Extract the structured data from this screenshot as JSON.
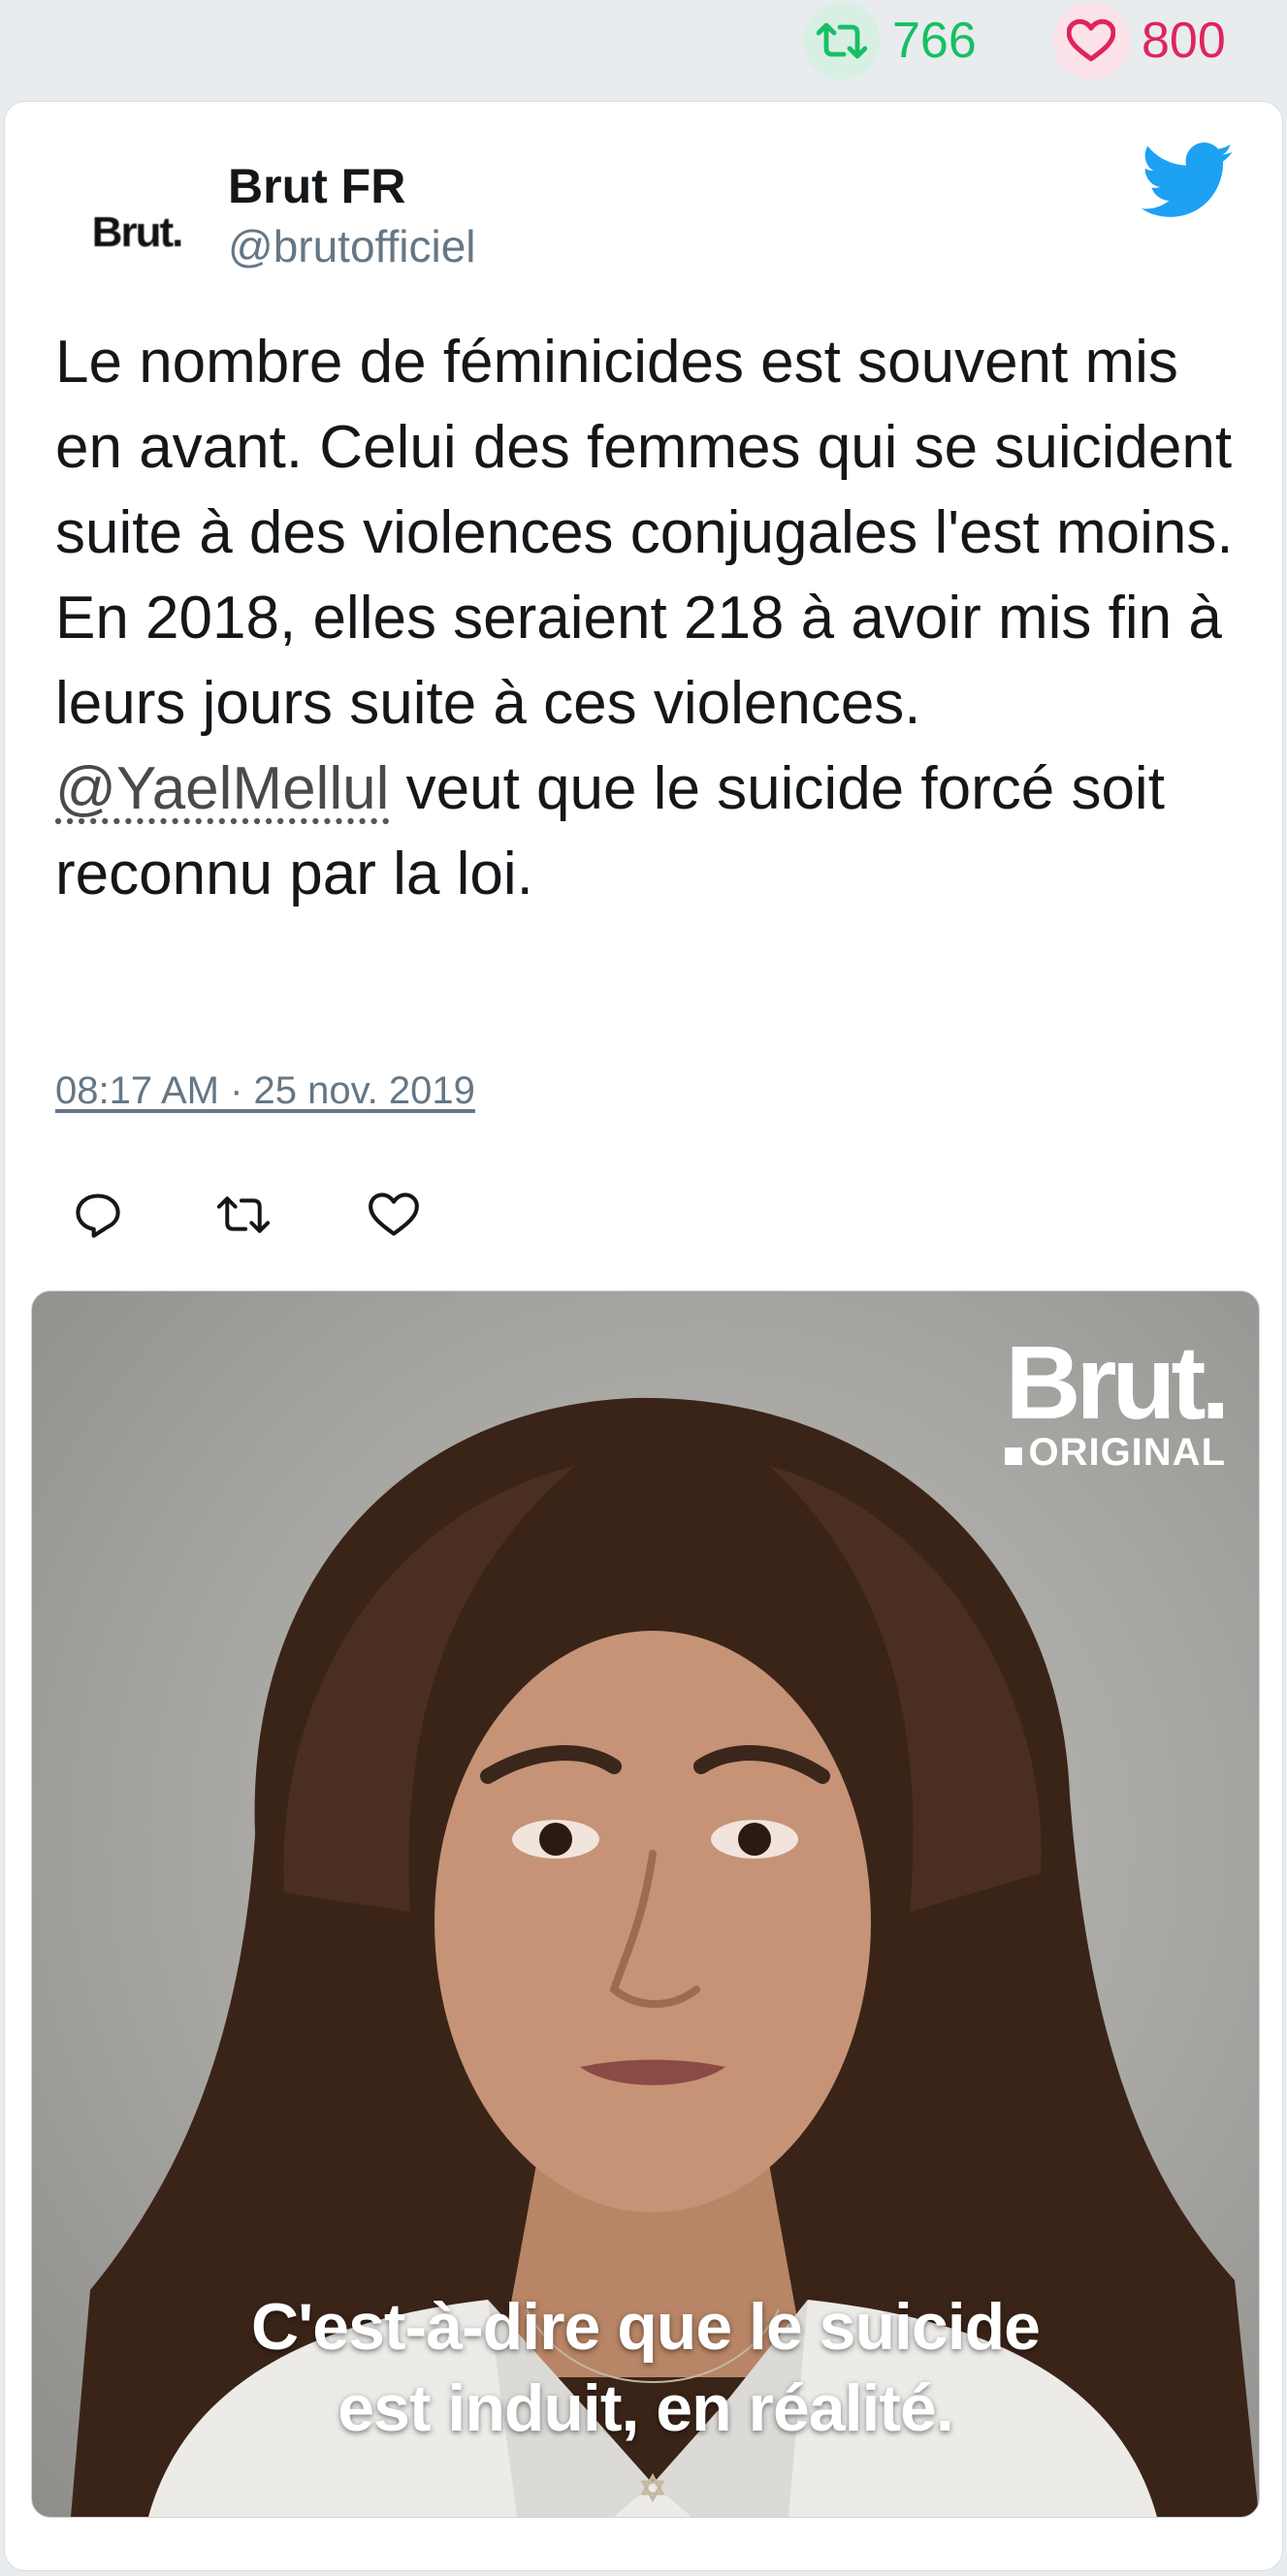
{
  "stats": {
    "retweets": "766",
    "likes": "800",
    "retweet_color": "#17bf63",
    "like_color": "#e0245e"
  },
  "tweet": {
    "avatar_text": "Brut.",
    "user_name": "Brut FR",
    "handle": "@brutofficiel",
    "text_before_mention": "Le nombre de féminicides est souvent mis en avant. Celui des femmes qui se suicident suite à des violences conjugales l'est moins. En 2018, elles seraient 218 à avoir mis fin à leurs jours suite à ces violences. ",
    "mention": "@YaelMellul",
    "text_after_mention": " veut que le suicide forcé soit reconnu par la loi.",
    "timestamp": "08:17 AM · 25 nov. 2019",
    "icons": {
      "platform": "twitter-bird-icon",
      "reply": "reply-icon",
      "retweet": "retweet-icon",
      "like": "heart-icon"
    },
    "accent_color": "#1da1f2"
  },
  "media": {
    "brand_word": "Brut.",
    "brand_sub": "ORIGINAL",
    "caption_line1": "C'est-à-dire que le suicide",
    "caption_line2": "est induit, en réalité."
  }
}
